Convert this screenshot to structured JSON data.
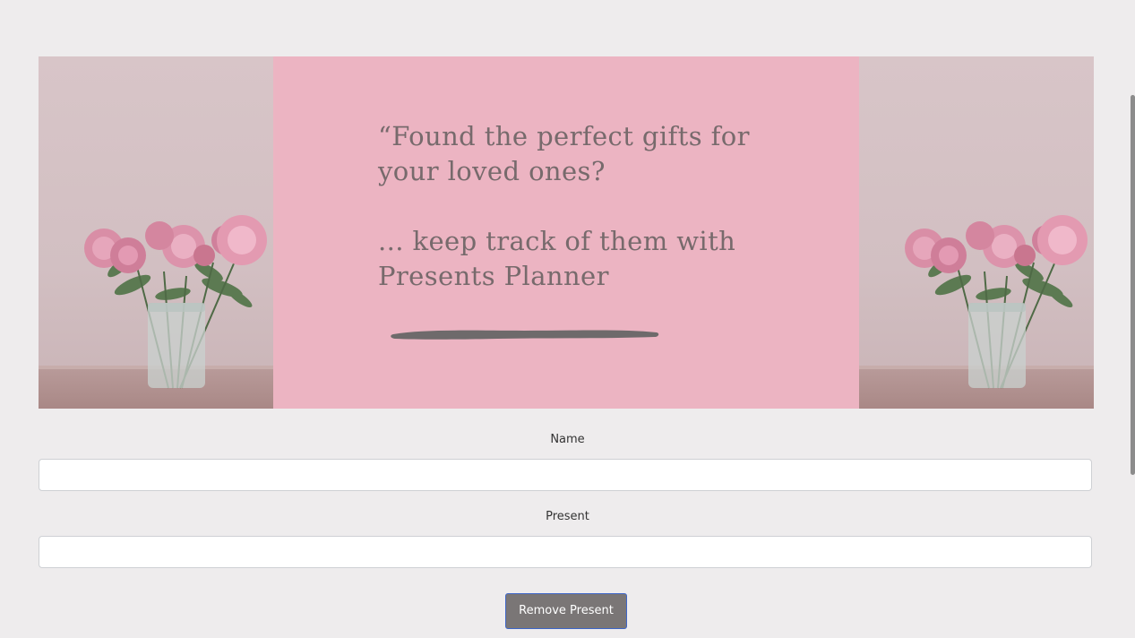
{
  "banner": {
    "quote": "“Found the perfect gifts for\nyour loved ones?\n\n... keep track of them with\nPresents Planner",
    "colors": {
      "pink_panel": "#ecb4c2",
      "quote_text": "#776a6c",
      "brush_stroke": "#6e6a6b"
    },
    "left_image": "peony-vase-photo",
    "right_image": "peony-vase-photo"
  },
  "form": {
    "name_label": "Name",
    "name_value": "",
    "present_label": "Present",
    "present_value": "",
    "remove_button_label": "Remove Present"
  },
  "theme": {
    "page_background": "#eeeced",
    "button_background": "#7a7676",
    "button_border": "#3e66c8"
  }
}
